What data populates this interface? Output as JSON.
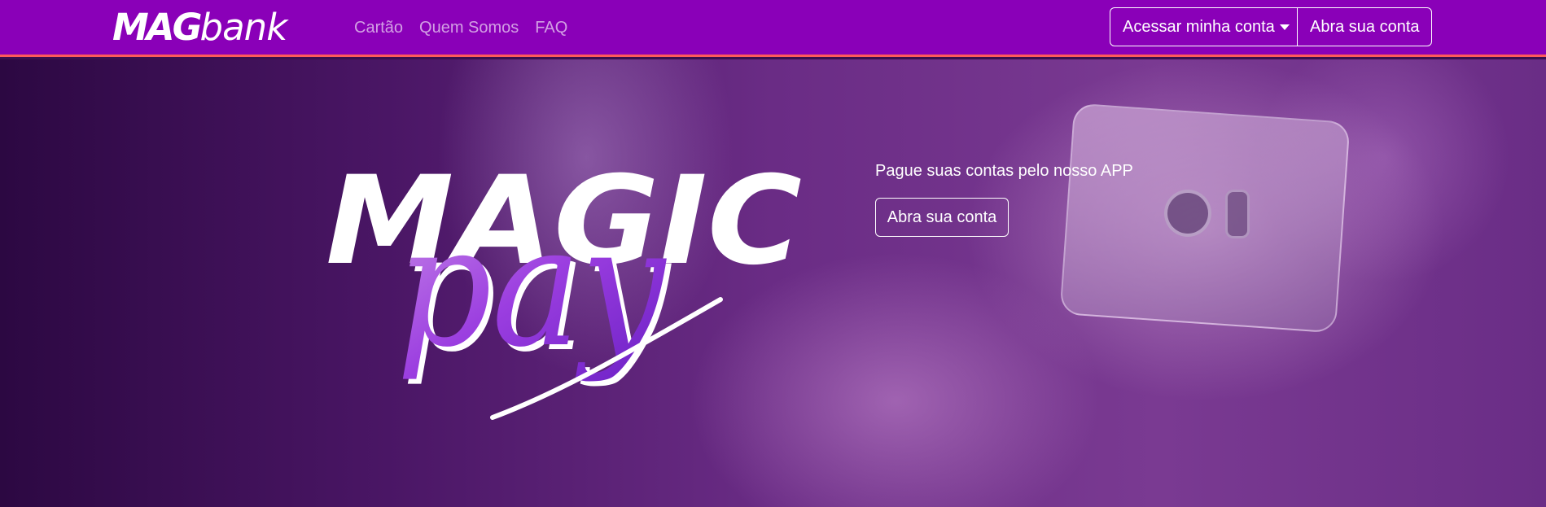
{
  "brand": {
    "part1": "MAG",
    "part2": "bank"
  },
  "nav": {
    "links": [
      "Cartão",
      "Quem Somos",
      "FAQ"
    ],
    "login_label": "Acessar minha conta",
    "open_account_label": "Abra sua conta"
  },
  "hero": {
    "logo_word1": "MAGIC",
    "logo_word2": "pay",
    "tagline": "Pague suas contas pelo nosso APP",
    "cta_label": "Abra sua conta"
  },
  "colors": {
    "navbar": "#8a00b8",
    "navbar_border": "#ff5a5a",
    "pay_purple": "#8b2bd6"
  },
  "icons": {
    "dropdown": "chevron-down-icon"
  }
}
